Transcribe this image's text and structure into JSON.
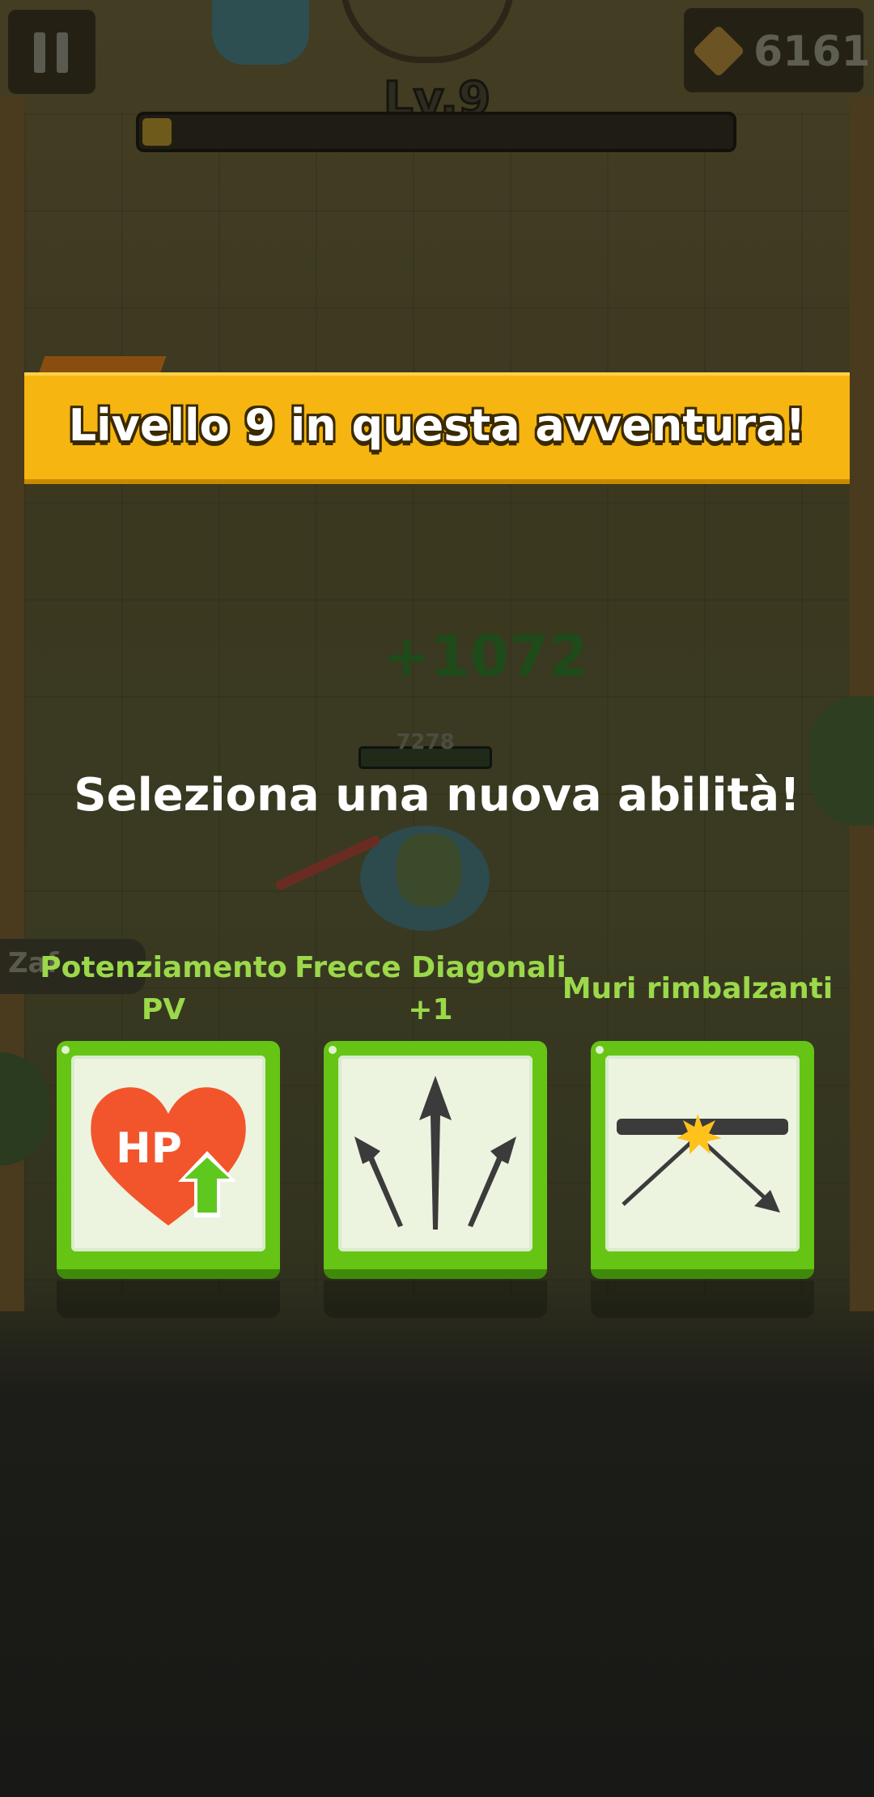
{
  "hud": {
    "gems": "6161",
    "level_label": "Lv.9",
    "xp_progress": 0.05,
    "damage_popup": "+1072",
    "enemy_hp": "7278",
    "tag_text": "Zaf"
  },
  "level_up": {
    "banner_text": "Livello 9 in questa avventura!",
    "prompt": "Seleziona una nuova abilità!"
  },
  "skills": [
    {
      "name": "Potenziamento PV",
      "icon": "hp-up-icon"
    },
    {
      "name": "Frecce Diagonali +1",
      "icon": "diagonal-arrows-icon"
    },
    {
      "name": "Muri rimbalzanti",
      "icon": "bouncy-wall-icon"
    }
  ],
  "colors": {
    "banner": "#f6b510",
    "card_green": "#66c414",
    "skill_name_green": "#9bd84a"
  }
}
